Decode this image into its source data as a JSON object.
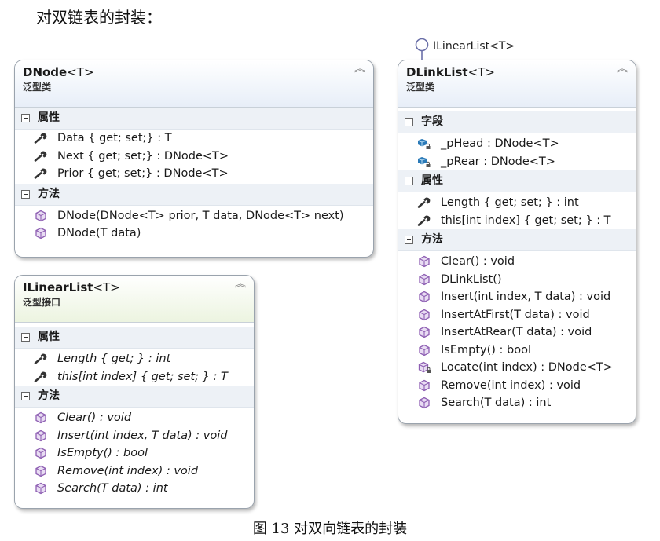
{
  "heading": "对双链表的封装：",
  "caption": "图 13  对双向链表的封装",
  "lollipop_label": "ILinearList<T>",
  "dnode": {
    "name": "DNode",
    "generic": "<T>",
    "kind": "泛型类",
    "sections": [
      {
        "title": "属性",
        "items": [
          {
            "icon": "wrench-icon",
            "text": "Data { get; set;} : T"
          },
          {
            "icon": "wrench-icon",
            "text": "Next { get; set;} : DNode<T>"
          },
          {
            "icon": "wrench-icon",
            "text": "Prior { get; set;} : DNode<T>"
          }
        ]
      },
      {
        "title": "方法",
        "items": [
          {
            "icon": "method-cube-icon",
            "text": "DNode(DNode<T> prior, T data, DNode<T> next)"
          },
          {
            "icon": "method-cube-icon",
            "text": "DNode(T data)"
          }
        ]
      }
    ]
  },
  "ilinear": {
    "name": "ILinearList",
    "generic": "<T>",
    "kind": "泛型接口",
    "sections": [
      {
        "title": "属性",
        "items": [
          {
            "icon": "wrench-icon",
            "text": "Length { get; } : int"
          },
          {
            "icon": "wrench-icon",
            "text": "this[int index] { get; set; } : T"
          }
        ]
      },
      {
        "title": "方法",
        "items": [
          {
            "icon": "method-cube-icon",
            "text": "Clear() : void"
          },
          {
            "icon": "method-cube-icon",
            "text": "Insert(int index, T data) : void"
          },
          {
            "icon": "method-cube-icon",
            "text": "IsEmpty() : bool"
          },
          {
            "icon": "method-cube-icon",
            "text": "Remove(int index) : void"
          },
          {
            "icon": "method-cube-icon",
            "text": "Search(T data) : int"
          }
        ]
      }
    ]
  },
  "dlink": {
    "name": "DLinkList",
    "generic": "<T>",
    "kind": "泛型类",
    "sections": [
      {
        "title": "字段",
        "items": [
          {
            "icon": "private-field-icon",
            "text": "_pHead : DNode<T>"
          },
          {
            "icon": "private-field-icon",
            "text": "_pRear : DNode<T>"
          }
        ]
      },
      {
        "title": "属性",
        "items": [
          {
            "icon": "wrench-icon",
            "text": "Length { get; set; } : int"
          },
          {
            "icon": "wrench-icon",
            "text": "this[int index] { get; set; } : T"
          }
        ]
      },
      {
        "title": "方法",
        "items": [
          {
            "icon": "method-cube-icon",
            "text": "Clear() : void"
          },
          {
            "icon": "method-cube-icon",
            "text": "DLinkList()"
          },
          {
            "icon": "method-cube-icon",
            "text": "Insert(int index, T data) : void"
          },
          {
            "icon": "method-cube-icon",
            "text": "InsertAtFirst(T data) : void"
          },
          {
            "icon": "method-cube-icon",
            "text": "InsertAtRear(T data) : void"
          },
          {
            "icon": "method-cube-icon",
            "text": "IsEmpty() : bool"
          },
          {
            "icon": "private-method-icon",
            "text": "Locate(int index) : DNode<T>"
          },
          {
            "icon": "method-cube-icon",
            "text": "Remove(int index) : void"
          },
          {
            "icon": "method-cube-icon",
            "text": "Search(T data) : int"
          }
        ]
      }
    ]
  },
  "colors": {
    "field_icon": "#2a7ab8",
    "method_icon": "#8e5fb3",
    "border": "#9aa3ad"
  }
}
